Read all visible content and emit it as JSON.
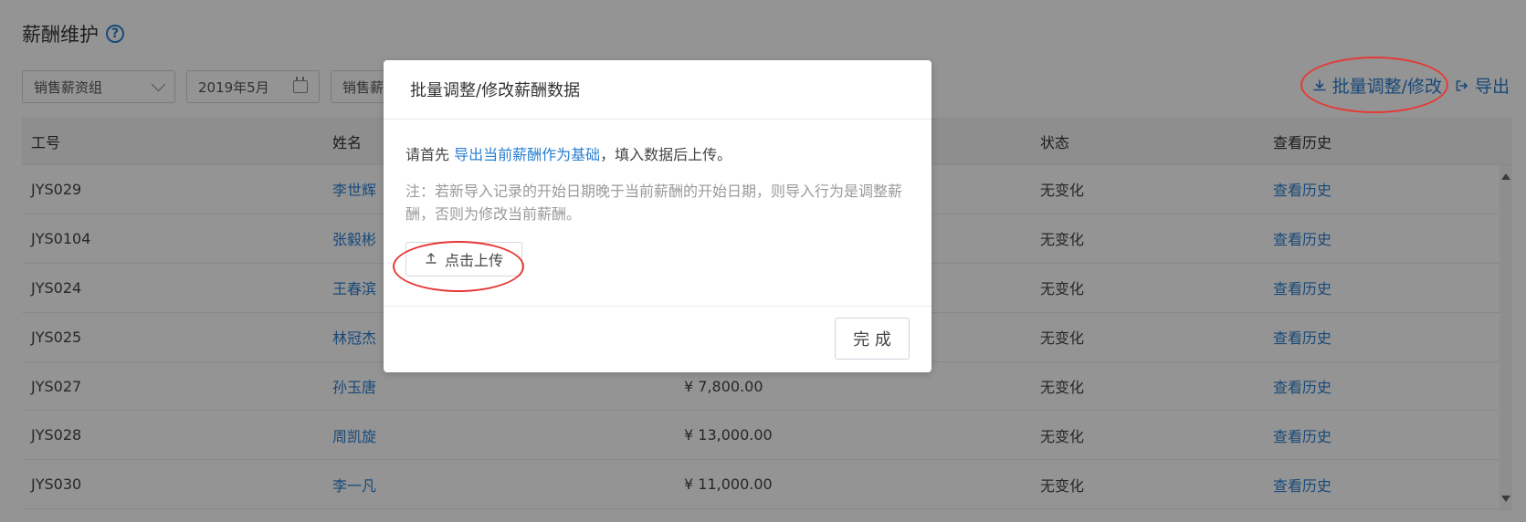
{
  "page": {
    "title": "薪酬维护",
    "help_icon": "question-icon"
  },
  "filters": {
    "group": "销售薪资组",
    "month": "2019年5月",
    "department": "销售薪"
  },
  "actions": {
    "batch_adjust": "批量调整/修改",
    "export": "导出"
  },
  "table": {
    "headers": {
      "id": "工号",
      "name": "姓名",
      "salary": "",
      "status": "状态",
      "history": "查看历史"
    },
    "rows": [
      {
        "id": "JYS029",
        "name": "李世辉",
        "salary": "",
        "status": "无变化",
        "history": "查看历史"
      },
      {
        "id": "JYS0104",
        "name": "张毅彬",
        "salary": "",
        "status": "无变化",
        "history": "查看历史"
      },
      {
        "id": "JYS024",
        "name": "王春滨",
        "salary": "",
        "status": "无变化",
        "history": "查看历史"
      },
      {
        "id": "JYS025",
        "name": "林冠杰",
        "salary": "",
        "status": "无变化",
        "history": "查看历史"
      },
      {
        "id": "JYS027",
        "name": "孙玉唐",
        "salary": "¥ 7,800.00",
        "status": "无变化",
        "history": "查看历史"
      },
      {
        "id": "JYS028",
        "name": "周凯旋",
        "salary": "¥ 13,000.00",
        "status": "无变化",
        "history": "查看历史"
      },
      {
        "id": "JYS030",
        "name": "李一凡",
        "salary": "¥ 11,000.00",
        "status": "无变化",
        "history": "查看历史"
      }
    ]
  },
  "modal": {
    "title": "批量调整/修改薪酬数据",
    "instruction_prefix": "请首先",
    "instruction_link": "导出当前薪酬作为基础",
    "instruction_suffix": "，填入数据后上传。",
    "note": "注：若新导入记录的开始日期晚于当前薪酬的开始日期，则导入行为是调整薪酬，否则为修改当前薪酬。",
    "upload_label": "点击上传",
    "done_label": "完 成"
  },
  "colors": {
    "link": "#2a7fd1",
    "annotation_red": "#e53935",
    "overlay": "rgba(0,0,0,0.42)"
  }
}
